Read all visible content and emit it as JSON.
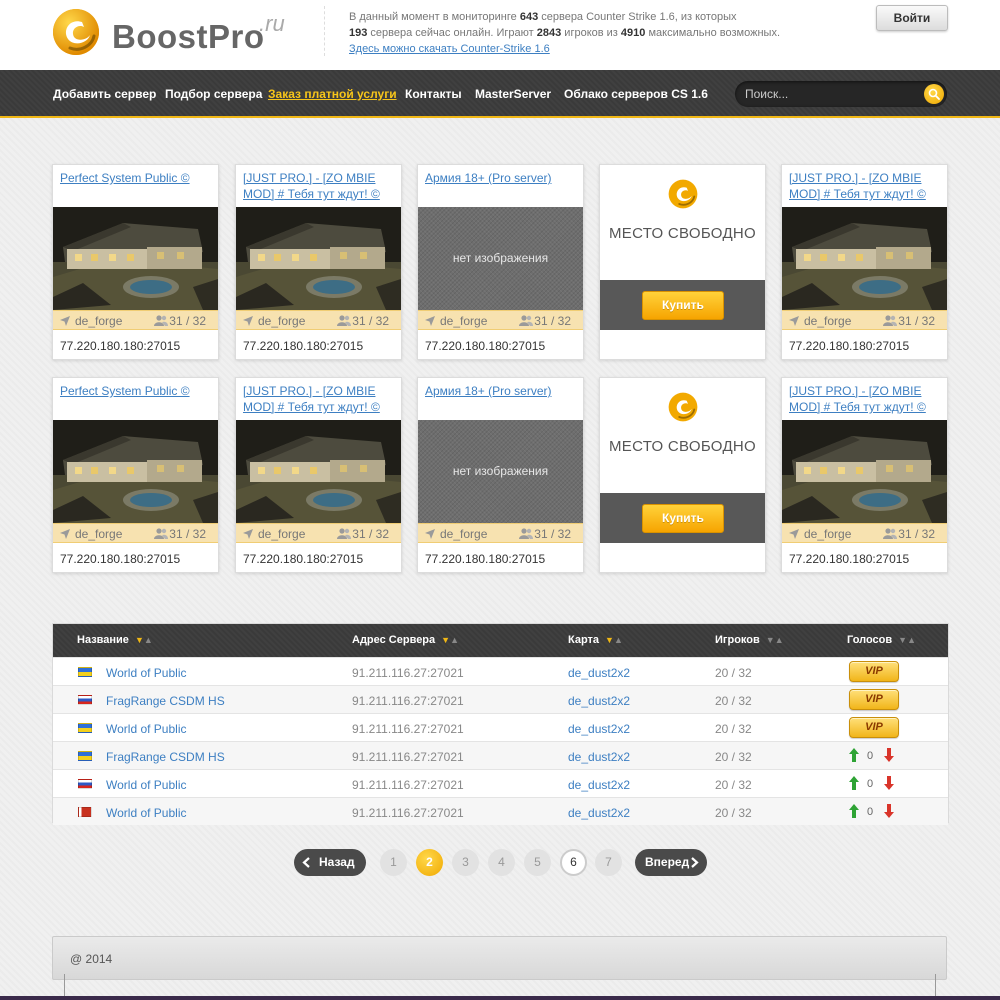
{
  "brand": {
    "name": "BoostPro",
    "suffix": ".ru",
    "colors": {
      "accent": "#f0b715",
      "link": "#3d7fc2",
      "nav_bg": "#3a3a3a"
    }
  },
  "header": {
    "stats_line1_a": "В данный момент в мониторинге ",
    "stats_servers": "643",
    "stats_line1_b": " сервера Counter Strike 1.6, из которых",
    "stats_online": "193",
    "stats_line2_a": " сервера сейчас онлайн. Играют ",
    "stats_players": "2843",
    "stats_line2_b": " игроков из ",
    "stats_max": "4910",
    "stats_line2_c": " максимально возможных.",
    "download_link": "Здесь можно скачать Counter-Strike 1.6",
    "login_label": "Войти"
  },
  "nav": {
    "items": [
      {
        "label": "Добавить сервер",
        "active": false
      },
      {
        "label": "Подбор сервера",
        "active": false
      },
      {
        "label": "Заказ платной услуги",
        "active": true
      },
      {
        "label": "Контакты",
        "active": false
      },
      {
        "label": "MasterServer",
        "active": false
      },
      {
        "label": "Облако серверов CS 1.6",
        "active": false
      }
    ],
    "search_placeholder": "Поиск..."
  },
  "cards_row1": [
    {
      "kind": "server",
      "title": "Perfect System Public ©",
      "image": "house",
      "map": "de_forge",
      "players": "31 / 32",
      "ip": "77.220.180.180:27015"
    },
    {
      "kind": "server",
      "title": "[JUST PRO.] - [ZO MBIE MOD] # Тебя тут ждут! ©",
      "image": "house",
      "map": "de_forge",
      "players": "31 / 32",
      "ip": "77.220.180.180:27015"
    },
    {
      "kind": "server",
      "title": "Армия 18+ (Pro server)",
      "image": "none",
      "no_image_text": "нет изображения",
      "map": "de_forge",
      "players": "31 / 32",
      "ip": "77.220.180.180:27015"
    },
    {
      "kind": "free",
      "free_text": "МЕСТО СВОБОДНО",
      "buy_label": "Купить"
    },
    {
      "kind": "server",
      "title": "[JUST PRO.] - [ZO MBIE MOD] # Тебя тут ждут! ©",
      "image": "house",
      "map": "de_forge",
      "players": "31 / 32",
      "ip": "77.220.180.180:27015"
    }
  ],
  "cards_row2": [
    {
      "kind": "server",
      "title": "Perfect System Public ©",
      "image": "house",
      "map": "de_forge",
      "players": "31 / 32",
      "ip": "77.220.180.180:27015"
    },
    {
      "kind": "server",
      "title": "[JUST PRO.] - [ZO MBIE MOD] # Тебя тут ждут! ©",
      "image": "house",
      "map": "de_forge",
      "players": "31 / 32",
      "ip": "77.220.180.180:27015"
    },
    {
      "kind": "server",
      "title": "Армия 18+ (Pro server)",
      "image": "none",
      "no_image_text": "нет изображения",
      "map": "de_forge",
      "players": "31 / 32",
      "ip": "77.220.180.180:27015"
    },
    {
      "kind": "free",
      "free_text": "МЕСТО СВОБОДНО",
      "buy_label": "Купить"
    },
    {
      "kind": "server",
      "title": "[JUST PRO.] - [ZO MBIE MOD] # Тебя тут ждут! ©",
      "image": "house",
      "map": "de_forge",
      "players": "31 / 32",
      "ip": "77.220.180.180:27015"
    }
  ],
  "table": {
    "columns": [
      "Название",
      "Адрес Сервера",
      "Карта",
      "Игроков",
      "Голосов"
    ],
    "rows": [
      {
        "flag": "ua",
        "name": "World of Public",
        "address": "91.211.116.27:27021",
        "map": "de_dust2x2",
        "players": "20 / 32",
        "vote_type": "vip",
        "vip_label": "VIP"
      },
      {
        "flag": "ru",
        "name": "FragRange CSDM HS",
        "address": "91.211.116.27:27021",
        "map": "de_dust2x2",
        "players": "20 / 32",
        "vote_type": "vip",
        "vip_label": "VIP"
      },
      {
        "flag": "ua",
        "name": "World of Public",
        "address": "91.211.116.27:27021",
        "map": "de_dust2x2",
        "players": "20 / 32",
        "vote_type": "vip",
        "vip_label": "VIP"
      },
      {
        "flag": "ua",
        "name": "FragRange CSDM HS",
        "address": "91.211.116.27:27021",
        "map": "de_dust2x2",
        "players": "20 / 32",
        "vote_type": "count",
        "votes": "0"
      },
      {
        "flag": "ru",
        "name": "World of Public",
        "address": "91.211.116.27:27021",
        "map": "de_dust2x2",
        "players": "20 / 32",
        "vote_type": "count",
        "votes": "0"
      },
      {
        "flag": "by",
        "name": "World of Public",
        "address": "91.211.116.27:27021",
        "map": "de_dust2x2",
        "players": "20 / 32",
        "vote_type": "count",
        "votes": "0"
      }
    ]
  },
  "pagination": {
    "prev_label": "Назад",
    "next_label": "Вперед",
    "pages": [
      "1",
      "2",
      "3",
      "4",
      "5",
      "6",
      "7"
    ],
    "current": "2"
  },
  "footer": {
    "text": "@ 2014"
  }
}
